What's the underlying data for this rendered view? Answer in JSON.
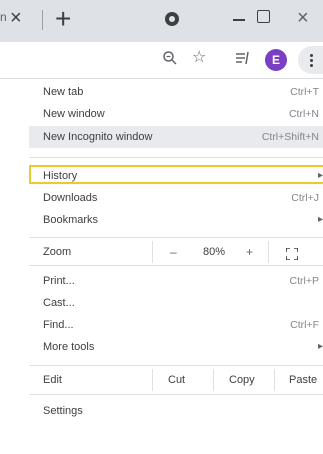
{
  "tabstrip": {
    "tab_fragment": "n",
    "tab_close_glyph": "×",
    "new_tab_glyph": "+",
    "window_close_glyph": "×"
  },
  "toolbar": {
    "profile_initial": "E",
    "star_glyph": "☆"
  },
  "menu": {
    "new_tab": {
      "label": "New tab",
      "shortcut": "Ctrl+T"
    },
    "new_window": {
      "label": "New window",
      "shortcut": "Ctrl+N"
    },
    "new_incognito": {
      "label": "New Incognito window",
      "shortcut": "Ctrl+Shift+N"
    },
    "history": {
      "label": "History",
      "arrow": "▸"
    },
    "downloads": {
      "label": "Downloads",
      "shortcut": "Ctrl+J"
    },
    "bookmarks": {
      "label": "Bookmarks",
      "arrow": "▸"
    },
    "zoom": {
      "label": "Zoom",
      "minus": "–",
      "level": "80%",
      "plus": "+"
    },
    "print": {
      "label": "Print...",
      "shortcut": "Ctrl+P"
    },
    "cast": {
      "label": "Cast..."
    },
    "find": {
      "label": "Find...",
      "shortcut": "Ctrl+F"
    },
    "more_tools": {
      "label": "More tools",
      "arrow": "▸"
    },
    "edit": {
      "label": "Edit",
      "cut": "Cut",
      "copy": "Copy",
      "paste": "Paste"
    },
    "settings": {
      "label": "Settings"
    }
  },
  "colors": {
    "highlight_border": "#e5cc30",
    "avatar_bg": "#7b3fc4",
    "hover_bg": "#e8eaed"
  }
}
